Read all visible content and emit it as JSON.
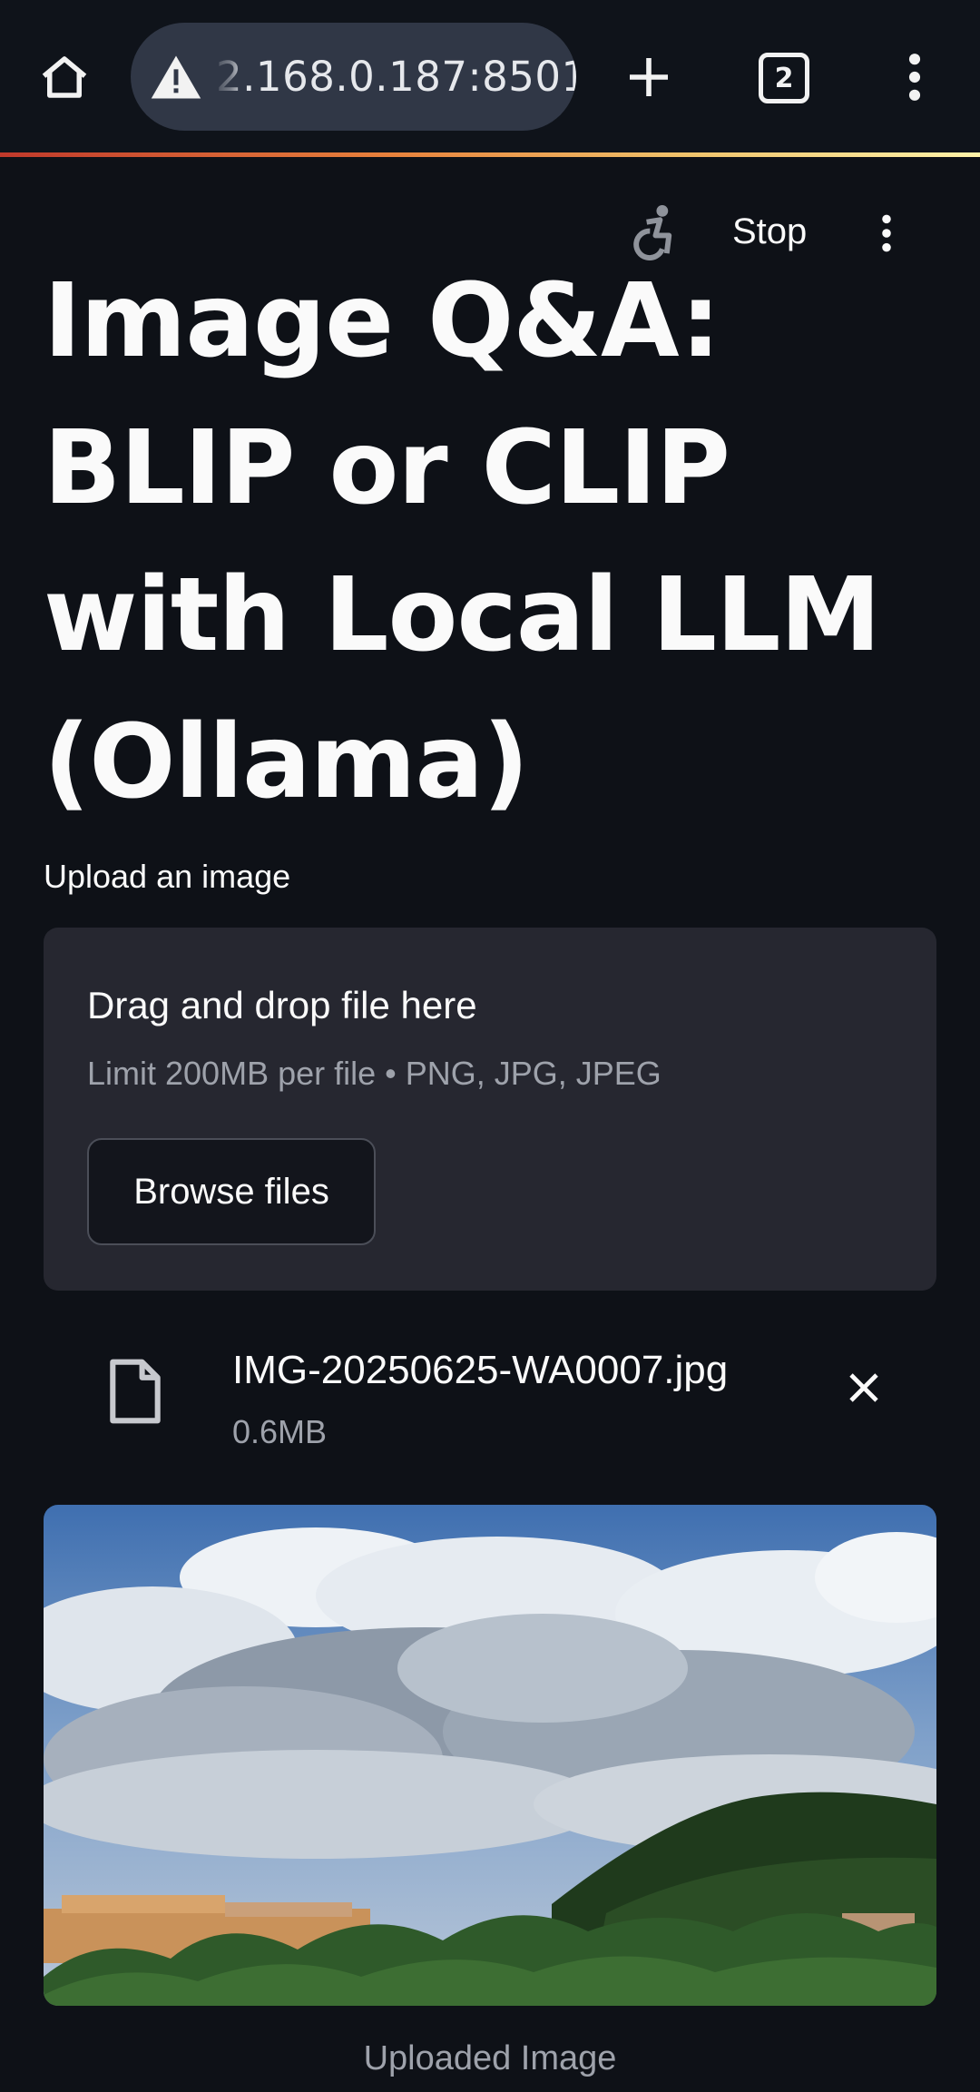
{
  "browser": {
    "url_display": "2.168.0.187:8501",
    "tab_count": "2",
    "icons": [
      "home-icon",
      "warning-icon",
      "plus-icon",
      "tabs-icon",
      "more-vert-icon"
    ]
  },
  "app": {
    "toolbar": {
      "stop_label": "Stop",
      "icons": [
        "running-man-icon",
        "more-vert-icon"
      ]
    },
    "title": "Image Q&A: BLIP or CLIP with Local LLM (Ollama)",
    "uploader": {
      "label": "Upload an image",
      "dropzone_text": "Drag and drop file here",
      "limit_text": "Limit 200MB per file • PNG, JPG, JPEG",
      "browse_label": "Browse files"
    },
    "uploaded_file": {
      "name": "IMG-20250625-WA0007.jpg",
      "size": "0.6MB"
    },
    "image_caption": "Uploaded Image"
  },
  "colors": {
    "background": "#0e1117",
    "dropzone": "#262730",
    "url_pill": "#303746",
    "muted_text": "#9ea2ab"
  }
}
